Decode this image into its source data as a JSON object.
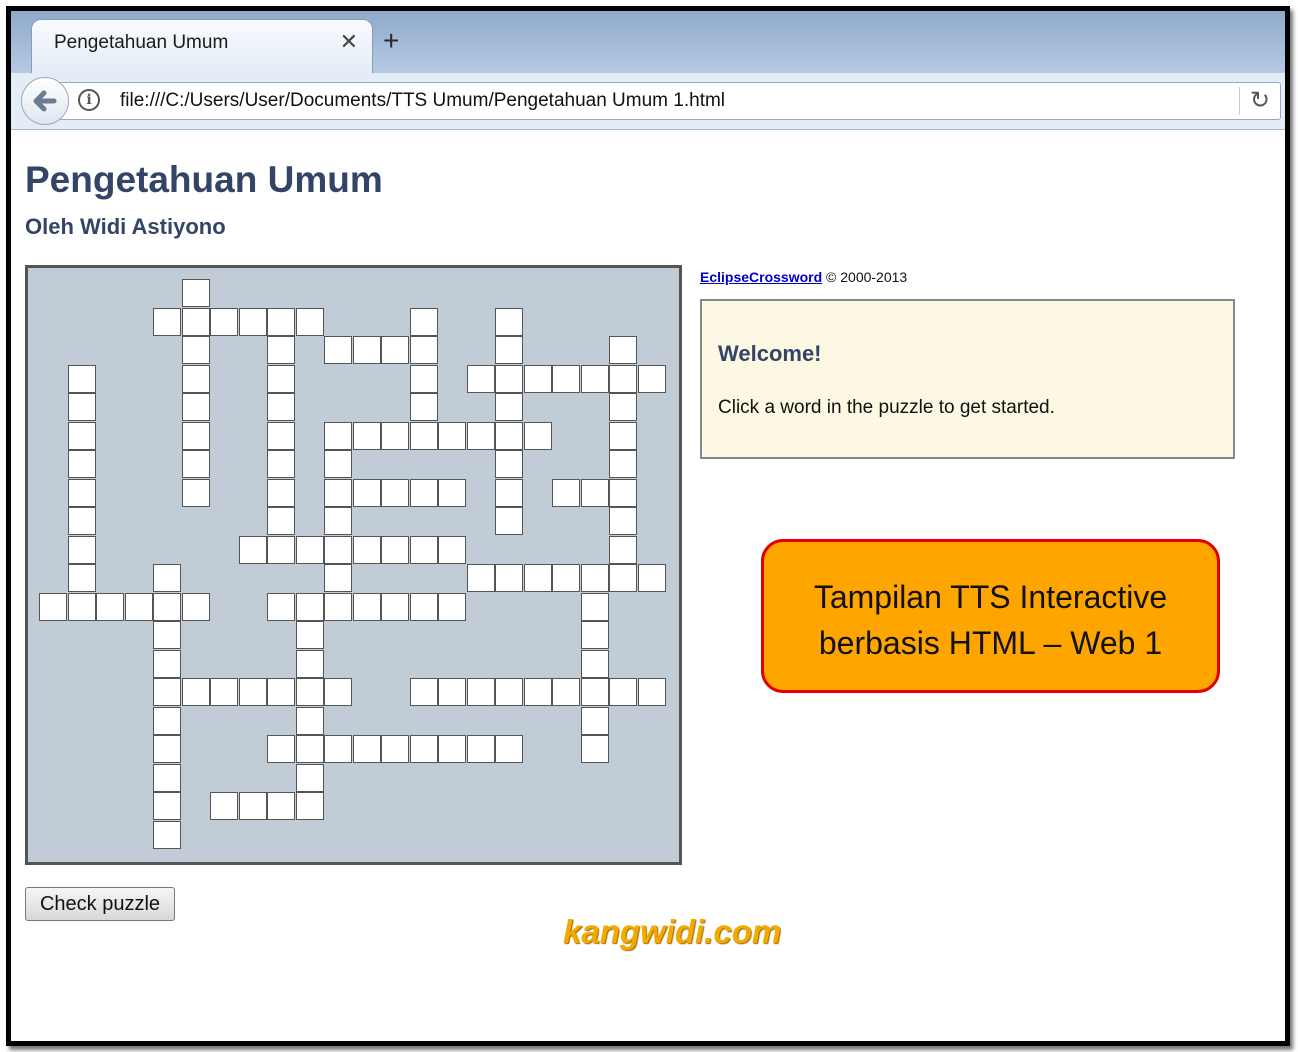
{
  "browser": {
    "tab_title": "Pengetahuan Umum",
    "tab_close_icon": "close-icon",
    "new_tab_icon": "plus-icon",
    "url": "file:///C:/Users/User/Documents/TTS Umum/Pengetahuan Umum 1.html",
    "back_icon": "arrow-left-icon",
    "info_icon": "info-icon",
    "reload_icon": "reload-icon"
  },
  "page": {
    "title": "Pengetahuan Umum",
    "author": "Oleh Widi Astiyono"
  },
  "credit": {
    "link_text": "EclipseCrossword",
    "suffix": "© 2000-2013"
  },
  "welcome": {
    "title": "Welcome!",
    "text": "Click a word in the puzzle to get started."
  },
  "callout": {
    "line1": "Tampilan TTS Interactive",
    "line2": "berbasis HTML – Web 1"
  },
  "check_button": "Check puzzle",
  "watermark": "kangwidi.com",
  "colors": {
    "grid_background": "#c2ccd6",
    "title_color": "#334466",
    "callout_fill": "#ffa500",
    "callout_border": "#e00000",
    "welcome_fill": "#fdf8e4"
  },
  "crossword": {
    "cells": [
      [
        0,
        5
      ],
      [
        1,
        4
      ],
      [
        1,
        5
      ],
      [
        1,
        6
      ],
      [
        1,
        7
      ],
      [
        1,
        8
      ],
      [
        1,
        9
      ],
      [
        1,
        13
      ],
      [
        1,
        16
      ],
      [
        2,
        5
      ],
      [
        2,
        8
      ],
      [
        2,
        10
      ],
      [
        2,
        11
      ],
      [
        2,
        12
      ],
      [
        2,
        13
      ],
      [
        2,
        16
      ],
      [
        2,
        20
      ],
      [
        3,
        1
      ],
      [
        3,
        5
      ],
      [
        3,
        8
      ],
      [
        3,
        13
      ],
      [
        3,
        15
      ],
      [
        3,
        16
      ],
      [
        3,
        17
      ],
      [
        3,
        18
      ],
      [
        3,
        19
      ],
      [
        3,
        20
      ],
      [
        3,
        21
      ],
      [
        4,
        1
      ],
      [
        4,
        5
      ],
      [
        4,
        8
      ],
      [
        4,
        13
      ],
      [
        4,
        16
      ],
      [
        4,
        20
      ],
      [
        5,
        1
      ],
      [
        5,
        5
      ],
      [
        5,
        8
      ],
      [
        5,
        10
      ],
      [
        5,
        11
      ],
      [
        5,
        12
      ],
      [
        5,
        13
      ],
      [
        5,
        14
      ],
      [
        5,
        15
      ],
      [
        5,
        16
      ],
      [
        5,
        17
      ],
      [
        5,
        20
      ],
      [
        6,
        1
      ],
      [
        6,
        5
      ],
      [
        6,
        8
      ],
      [
        6,
        10
      ],
      [
        6,
        16
      ],
      [
        6,
        20
      ],
      [
        7,
        1
      ],
      [
        7,
        5
      ],
      [
        7,
        8
      ],
      [
        7,
        10
      ],
      [
        7,
        11
      ],
      [
        7,
        12
      ],
      [
        7,
        13
      ],
      [
        7,
        14
      ],
      [
        7,
        16
      ],
      [
        7,
        18
      ],
      [
        7,
        19
      ],
      [
        7,
        20
      ],
      [
        8,
        1
      ],
      [
        8,
        8
      ],
      [
        8,
        10
      ],
      [
        8,
        16
      ],
      [
        8,
        20
      ],
      [
        9,
        1
      ],
      [
        9,
        7
      ],
      [
        9,
        8
      ],
      [
        9,
        9
      ],
      [
        9,
        10
      ],
      [
        9,
        11
      ],
      [
        9,
        12
      ],
      [
        9,
        13
      ],
      [
        9,
        14
      ],
      [
        9,
        20
      ],
      [
        10,
        1
      ],
      [
        10,
        4
      ],
      [
        10,
        10
      ],
      [
        10,
        15
      ],
      [
        10,
        16
      ],
      [
        10,
        17
      ],
      [
        10,
        18
      ],
      [
        10,
        19
      ],
      [
        10,
        20
      ],
      [
        10,
        21
      ],
      [
        11,
        0
      ],
      [
        11,
        1
      ],
      [
        11,
        2
      ],
      [
        11,
        3
      ],
      [
        11,
        4
      ],
      [
        11,
        5
      ],
      [
        11,
        8
      ],
      [
        11,
        9
      ],
      [
        11,
        10
      ],
      [
        11,
        11
      ],
      [
        11,
        12
      ],
      [
        11,
        13
      ],
      [
        11,
        14
      ],
      [
        11,
        19
      ],
      [
        12,
        4
      ],
      [
        12,
        9
      ],
      [
        12,
        19
      ],
      [
        13,
        4
      ],
      [
        13,
        9
      ],
      [
        13,
        19
      ],
      [
        14,
        4
      ],
      [
        14,
        5
      ],
      [
        14,
        6
      ],
      [
        14,
        7
      ],
      [
        14,
        8
      ],
      [
        14,
        9
      ],
      [
        14,
        10
      ],
      [
        14,
        13
      ],
      [
        14,
        14
      ],
      [
        14,
        15
      ],
      [
        14,
        16
      ],
      [
        14,
        17
      ],
      [
        14,
        18
      ],
      [
        14,
        19
      ],
      [
        14,
        20
      ],
      [
        14,
        21
      ],
      [
        15,
        4
      ],
      [
        15,
        9
      ],
      [
        15,
        19
      ],
      [
        16,
        4
      ],
      [
        16,
        8
      ],
      [
        16,
        9
      ],
      [
        16,
        10
      ],
      [
        16,
        11
      ],
      [
        16,
        12
      ],
      [
        16,
        13
      ],
      [
        16,
        14
      ],
      [
        16,
        15
      ],
      [
        16,
        16
      ],
      [
        16,
        19
      ],
      [
        17,
        4
      ],
      [
        17,
        9
      ],
      [
        18,
        4
      ],
      [
        18,
        6
      ],
      [
        18,
        7
      ],
      [
        18,
        8
      ],
      [
        18,
        9
      ],
      [
        19,
        4
      ]
    ]
  }
}
